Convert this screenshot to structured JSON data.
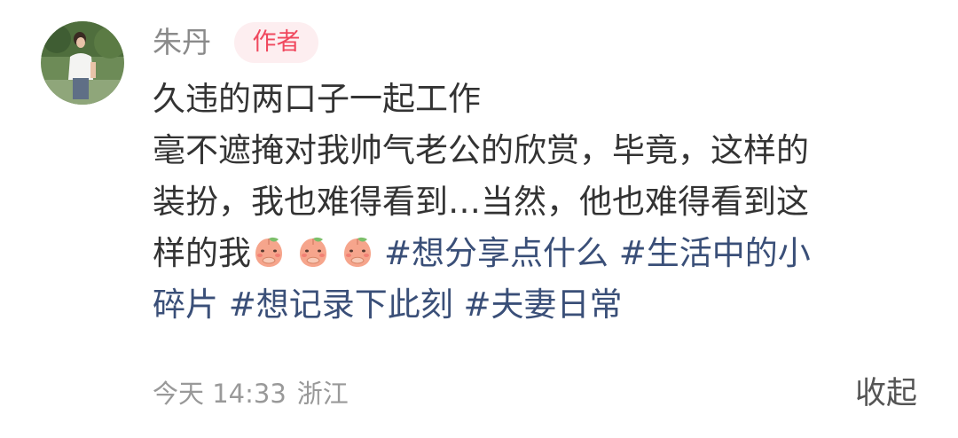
{
  "author": {
    "avatar_icon": "avatar-photo",
    "name": "朱丹",
    "badge": "作者",
    "badge_color": "#f0485e",
    "badge_bg": "#fdeef0"
  },
  "post": {
    "lines": [
      "久违的两口子一起工作",
      "毫不遮掩对我帅气老公的欣赏，毕竟，这样的",
      "装扮，我也难得看到…当然，他也难得看到这"
    ],
    "line4_text": "样的我",
    "emoji_icon": "peach-face-hand-over-mouth-emoji",
    "line4_tags": [
      "#想分享点什么",
      "#生活中的小"
    ],
    "line5_tags": [
      "碎片",
      "#想记录下此刻",
      "#夫妻日常"
    ],
    "tag_color": "#3a4f78"
  },
  "meta": {
    "time": "今天 14:33",
    "location": "浙江"
  },
  "actions": {
    "collapse_label": "收起"
  }
}
